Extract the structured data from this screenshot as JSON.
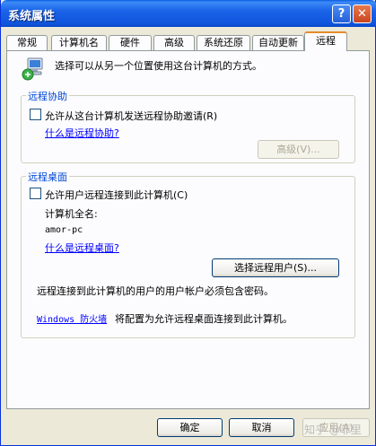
{
  "window": {
    "title": "系统属性",
    "help_glyph": "?",
    "close_glyph": "✕"
  },
  "tabs": [
    {
      "label": "常规"
    },
    {
      "label": "计算机名"
    },
    {
      "label": "硬件"
    },
    {
      "label": "高级"
    },
    {
      "label": "系统还原"
    },
    {
      "label": "自动更新"
    },
    {
      "label": "远程",
      "active": true
    }
  ],
  "intro": "选择可以从另一个位置使用这台计算机的方式。",
  "remote_assistance": {
    "group_label": "远程协助",
    "checkbox_label": "允许从这台计算机发送远程协助邀请(R)",
    "checked": false,
    "link": "什么是远程协助?",
    "advanced_button": "高级(V)..."
  },
  "remote_desktop": {
    "group_label": "远程桌面",
    "checkbox_label": "允许用户远程连接到此计算机(C)",
    "checked": false,
    "full_name_label": "计算机全名:",
    "computer_name": "amor-pc",
    "link": "什么是远程桌面?",
    "select_users_button": "选择远程用户(S)...",
    "password_note": "远程连接到此计算机的用户的用户帐户必须包含密码。",
    "firewall_link": "Windows 防火墙",
    "firewall_text": "将配置为允许远程桌面连接到此计算机。"
  },
  "footer": {
    "ok": "确定",
    "cancel": "取消",
    "apply": "应用(A)"
  },
  "watermark": "知乎 @菲里"
}
